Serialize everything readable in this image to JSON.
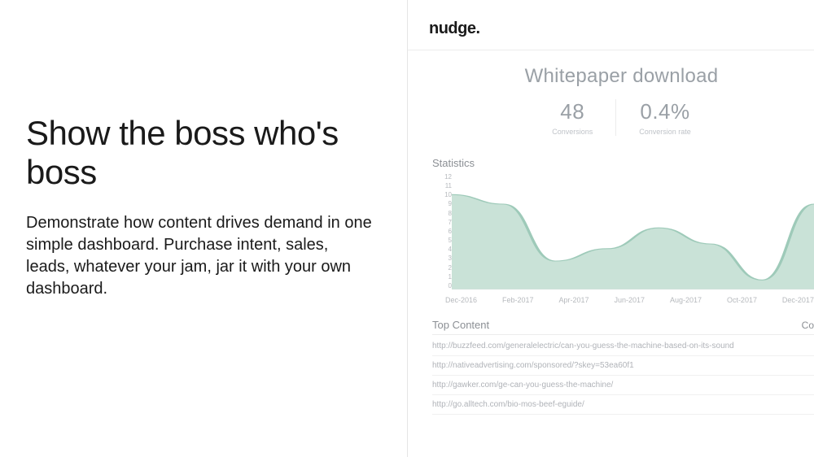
{
  "left": {
    "headline": "Show the boss who's boss",
    "body": "Demonstrate how content drives demand in one simple dashboard. Purchase intent, sales, leads, whatever your jam, jar it with your own dashboard."
  },
  "brand": "nudge",
  "dashboard": {
    "title": "Whitepaper download",
    "stats": [
      {
        "value": "48",
        "label": "Conversions"
      },
      {
        "value": "0.4%",
        "label": "Conversion rate"
      }
    ],
    "statistics_label": "Statistics",
    "top_content_label": "Top Content",
    "top_content_right": "Co",
    "urls": [
      "http://buzzfeed.com/generalelectric/can-you-guess-the-machine-based-on-its-sound",
      "http://nativeadvertising.com/sponsored/?skey=53ea60f1",
      "http://gawker.com/ge-can-you-guess-the-machine/",
      "http://go.alltech.com/bio-mos-beef-eguide/"
    ]
  },
  "chart_data": {
    "type": "area",
    "title": "Statistics",
    "xlabel": "",
    "ylabel": "",
    "ylim": [
      0,
      12
    ],
    "y_ticks": [
      "12",
      "11",
      "10",
      "9",
      "8",
      "7",
      "6",
      "5",
      "4",
      "3",
      "2",
      "1",
      "0"
    ],
    "categories": [
      "Dec-2016",
      "Feb-2017",
      "Apr-2017",
      "Jun-2017",
      "Aug-2017",
      "Oct-2017",
      "Dec-2017"
    ],
    "values": [
      10,
      9,
      3,
      4.3,
      6.5,
      4.8,
      1,
      9
    ],
    "fill_color": "#c9e2d7",
    "stroke_color": "#9ecab9"
  }
}
